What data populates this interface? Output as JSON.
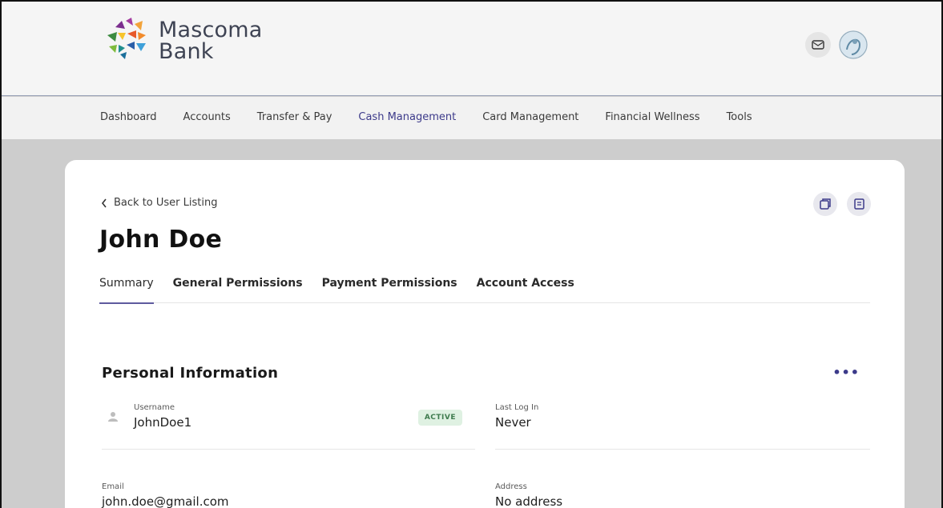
{
  "brand": {
    "line1": "Mascoma",
    "line2": "Bank"
  },
  "nav": {
    "items": [
      "Dashboard",
      "Accounts",
      "Transfer & Pay",
      "Cash Management",
      "Card Management",
      "Financial Wellness",
      "Tools"
    ],
    "active": "Cash Management"
  },
  "page": {
    "back_label": "Back to User Listing",
    "title": "John Doe",
    "tabs": [
      "Summary",
      "General Permissions",
      "Payment Permissions",
      "Account Access"
    ],
    "active_tab": "Summary"
  },
  "personal_info": {
    "title": "Personal Information",
    "more_label": "•••",
    "username_label": "Username",
    "username_value": "JohnDoe1",
    "status_badge": "ACTIVE",
    "last_login_label": "Last Log In",
    "last_login_value": "Never",
    "email_label": "Email",
    "email_value": "john.doe@gmail.com",
    "address_label": "Address",
    "address_value": "No address"
  },
  "icons": {
    "mail": "mail-icon",
    "avatar": "user-avatar-icon",
    "back": "chevron-left-icon",
    "action1": "copy-icon",
    "action2": "document-icon",
    "user": "person-icon"
  },
  "colors": {
    "accent": "#3c3a8a",
    "active_badge_bg": "#dff1e2",
    "active_badge_text": "#3f7b4e"
  }
}
